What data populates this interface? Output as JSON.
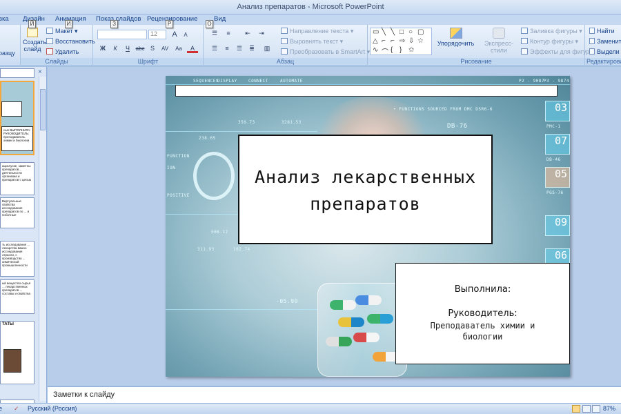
{
  "window": {
    "title": "Анализ препаратов - Microsoft PowerPoint"
  },
  "tabs": [
    {
      "label": "вка",
      "keytip": ""
    },
    {
      "label": "Дизайн",
      "keytip": ""
    },
    {
      "label": "Анимация",
      "keytip": ""
    },
    {
      "label": "Показ слайдов",
      "keytip": ""
    },
    {
      "label": "Рецензирование",
      "keytip": ""
    },
    {
      "label": "Вид",
      "keytip": ""
    }
  ],
  "keytips": [
    "Й",
    "И",
    "З",
    "Р",
    "О"
  ],
  "ribbon": {
    "clipboard": {
      "paste_fragment": "разцу"
    },
    "slides": {
      "new_slide": "Создать слайд",
      "layout": "Макет",
      "reset": "Восстановить",
      "delete": "Удалить",
      "label": "Слайды"
    },
    "font": {
      "font_name": "",
      "font_size": "12",
      "grow": "A",
      "shrink": "A",
      "bold": "Ж",
      "italic": "К",
      "underline": "Ч",
      "strike": "abc",
      "shadow": "S",
      "spacing": "AV",
      "case": "Aa",
      "color": "A",
      "label": "Шрифт"
    },
    "paragraph": {
      "text_direction": "Направление текста",
      "align_text": "Выровнять текст",
      "smartart": "Преобразовать в SmartArt",
      "label": "Абзац"
    },
    "drawing": {
      "arrange": "Упорядочить",
      "quick_styles": "Экспресс-стили",
      "shape_fill": "Заливка фигуры",
      "shape_outline": "Контур фигуры",
      "shape_effects": "Эффекты для фигур",
      "label": "Рисование"
    },
    "editing": {
      "find": "Найти",
      "replace": "Заменит",
      "select": "Выдели",
      "label": "Редактирова"
    }
  },
  "thumbnails": [
    {
      "text": "",
      "selected": false
    },
    {
      "text": "ных ВЫПОЛНИЛА: РУКОВОДИТЕЛЬ: преподаватель химии и биологии",
      "selected": true
    },
    {
      "text": "ацоклуске, заметны препаратов... деятельности организма и препаратов с целью",
      "selected": false
    },
    {
      "text": "Виртуальные свойства исследования препаратов по ... и побочные",
      "selected": false
    },
    {
      "text": "ть исследования ... лекарства важно исследования отрасли, с производства ... химической промышленности",
      "selected": false
    },
    {
      "text": "ый вещество сырья ... лекарственных препаратов ... составы и свойства",
      "selected": false
    },
    {
      "text": "ТАТЫ",
      "selected": false
    }
  ],
  "slide": {
    "title": "Анализ лекарственных препаратов",
    "author_label": "Выполнила:",
    "supervisor_label": "Руководитель:",
    "supervisor_value": "Преподаватель химии и биологии",
    "hud": {
      "tabs": [
        "SEQUENCES",
        "DISPLAY",
        "CONNECT",
        "AUTOMATE"
      ],
      "tr_codes": [
        "P2 - 9087",
        "P3 - 9874"
      ],
      "functions": "• FUNCTIONS SOURCED FROM DMC DSR6-6",
      "code": "DB-76",
      "tiles": [
        "03",
        "07",
        "05",
        "09",
        "06"
      ],
      "tile_labels": [
        "PMC-1",
        "DB-46",
        "PGS-76"
      ],
      "values": [
        "356.73",
        "3281.53",
        "238.65",
        "506.12",
        "311.93",
        "162.74",
        "-05.90"
      ],
      "side_labels": [
        "FUNCTION",
        "ION",
        "POSITIVE"
      ]
    }
  },
  "notes": {
    "placeholder": "Заметки к слайду"
  },
  "statusbar": {
    "page": "е",
    "language": "Русский (Россия)",
    "zoom": "87%"
  }
}
